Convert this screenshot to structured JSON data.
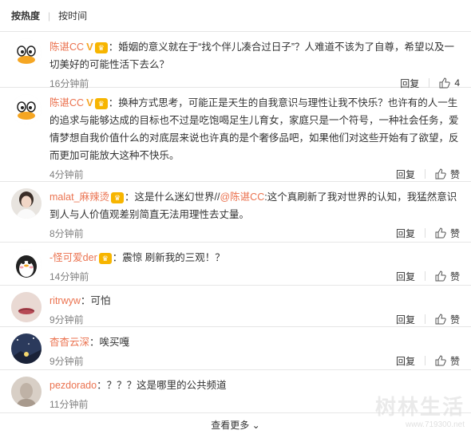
{
  "tabs": [
    {
      "label": "按热度",
      "active": true
    },
    {
      "label": "按时间",
      "active": false
    }
  ],
  "comments": [
    {
      "user": "陈谌CC",
      "verified": true,
      "member": true,
      "text": "：婚姻的意义就在于“找个伴儿凑合过日子”？人难道不该为了自尊，希望以及一切美好的可能性活下去么？",
      "time": "16分钟前",
      "reply": "回复",
      "like": "4",
      "avatar_icon": "duck-avatar"
    },
    {
      "user": "陈谌CC",
      "verified": true,
      "member": true,
      "text": "：换种方式思考，可能正是天生的自我意识与理性让我不快乐？也许有的人一生的追求与能够达成的目标也不过是吃饱喝足生儿育女，家庭只是一个符号，一种社会任务，爱情梦想自我价值什么的对底层来说也许真的是个奢侈品吧，如果他们对这些开始有了欲望，反而更加可能放大这种不快乐。",
      "time": "4分钟前",
      "reply": "回复",
      "like": "赞",
      "avatar_icon": "duck-avatar"
    },
    {
      "user": "malat_麻辣烫",
      "verified": false,
      "member": true,
      "text_before": "：这是什么迷幻世界//",
      "mention": "@陈谌CC",
      "text_after": ":这个真刷新了我对世界的认知，我猛然意识到人与人价值观差别简直无法用理性去丈量。",
      "time": "8分钟前",
      "reply": "回复",
      "like": "赞",
      "avatar_icon": "girl-photo-avatar"
    },
    {
      "user": "-怪可爱der",
      "verified": false,
      "member": true,
      "text": "：震惊 刷新我的三观！？",
      "time": "14分钟前",
      "reply": "回复",
      "like": "赞",
      "avatar_icon": "penguin-avatar"
    },
    {
      "user": "ritrwyw",
      "verified": false,
      "member": false,
      "text": "：可怕",
      "time": "9分钟前",
      "reply": "回复",
      "like": "赞",
      "avatar_icon": "lips-photo-avatar"
    },
    {
      "user": "杳杳云深",
      "verified": false,
      "member": false,
      "text": "：唉买嘎",
      "time": "9分钟前",
      "reply": "回复",
      "like": "赞",
      "avatar_icon": "night-sky-avatar"
    },
    {
      "user": "pezdorado",
      "verified": false,
      "member": false,
      "text": "：？？？这是哪里的公共频道",
      "time": "11分钟前",
      "reply": "回复",
      "like": "赞",
      "avatar_icon": "sketch-avatar"
    }
  ],
  "see_more": "查看更多",
  "watermark": {
    "logo": "树林生活",
    "url": "www.719300.net"
  },
  "colors": {
    "username": "#eb7350",
    "time": "#808080",
    "divider": "#e6e6e6"
  }
}
